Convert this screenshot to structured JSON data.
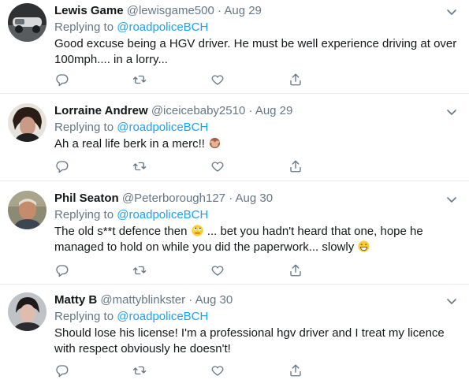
{
  "tweets": [
    {
      "name": "Lewis Game",
      "handle": "@lewisgame500",
      "dot": "·",
      "date": "Aug 29",
      "replying_prefix": "Replying to ",
      "replying_to": "@roadpoliceBCH",
      "text": "Good excuse being a HGV driver. He must be well experience driving at over 100mph.... in a lorry..."
    },
    {
      "name": "Lorraine Andrew",
      "handle": "@iceicebaby2510",
      "dot": "·",
      "date": "Aug 29",
      "replying_prefix": "Replying to ",
      "replying_to": "@roadpoliceBCH",
      "text": "Ah a real life berk in a merc!! ",
      "emoji": "see-no-evil-monkey"
    },
    {
      "name": "Phil Seaton",
      "handle": "@Peterborough127",
      "dot": "·",
      "date": "Aug 30",
      "replying_prefix": "Replying to ",
      "replying_to": "@roadpoliceBCH",
      "text_part1": "The old s**t defence then ",
      "emoji1": "face-rolling-eyes",
      "text_part2": " ... bet you hadn't heard that one, hope he managed to hold on while you did the paperwork... slowly ",
      "emoji2": "grinning-face"
    },
    {
      "name": "Matty B",
      "handle": "@mattyblinkster",
      "dot": "·",
      "date": "Aug 30",
      "replying_prefix": "Replying to ",
      "replying_to": "@roadpoliceBCH",
      "text": "Should lose his license! I'm a professional hgv driver and I treat my licence with respect obviously he doesn't!"
    }
  ],
  "icons": {
    "reply": "reply-icon",
    "retweet": "retweet-icon",
    "like": "like-icon",
    "share": "share-icon",
    "more": "chevron-down-icon"
  },
  "colors": {
    "link": "#1da1f2",
    "secondary_text": "#657786",
    "divider": "#e6ecf0"
  }
}
